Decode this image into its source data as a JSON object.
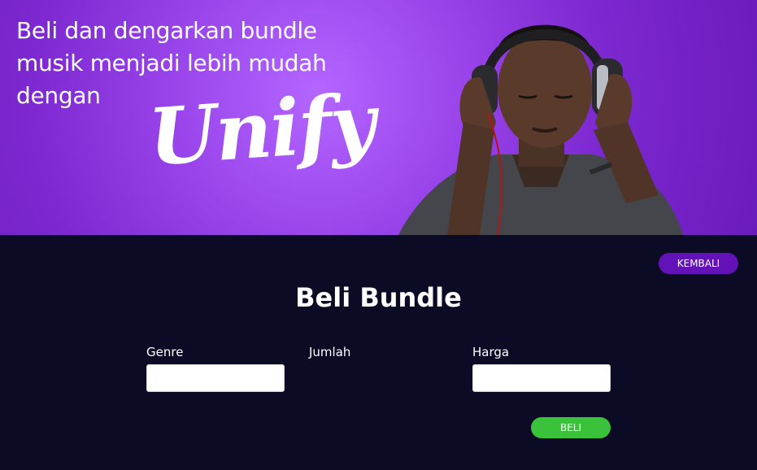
{
  "hero": {
    "tagline_line1": "Beli dan dengarkan bundle",
    "tagline_line2": "musik menjadi lebih mudah",
    "tagline_line3": "dengan",
    "brand": "Unify"
  },
  "nav": {
    "back_label": "KEMBALI"
  },
  "form": {
    "title": "Beli Bundle",
    "genre_label": "Genre",
    "genre_value": "",
    "jumlah_label": "Jumlah",
    "harga_label": "Harga",
    "harga_value": "",
    "buy_label": "BELI"
  },
  "colors": {
    "hero_purple": "#8a35df",
    "page_bg": "#0b0b25",
    "back_button": "#6312b8",
    "buy_button": "#3ac23a"
  }
}
